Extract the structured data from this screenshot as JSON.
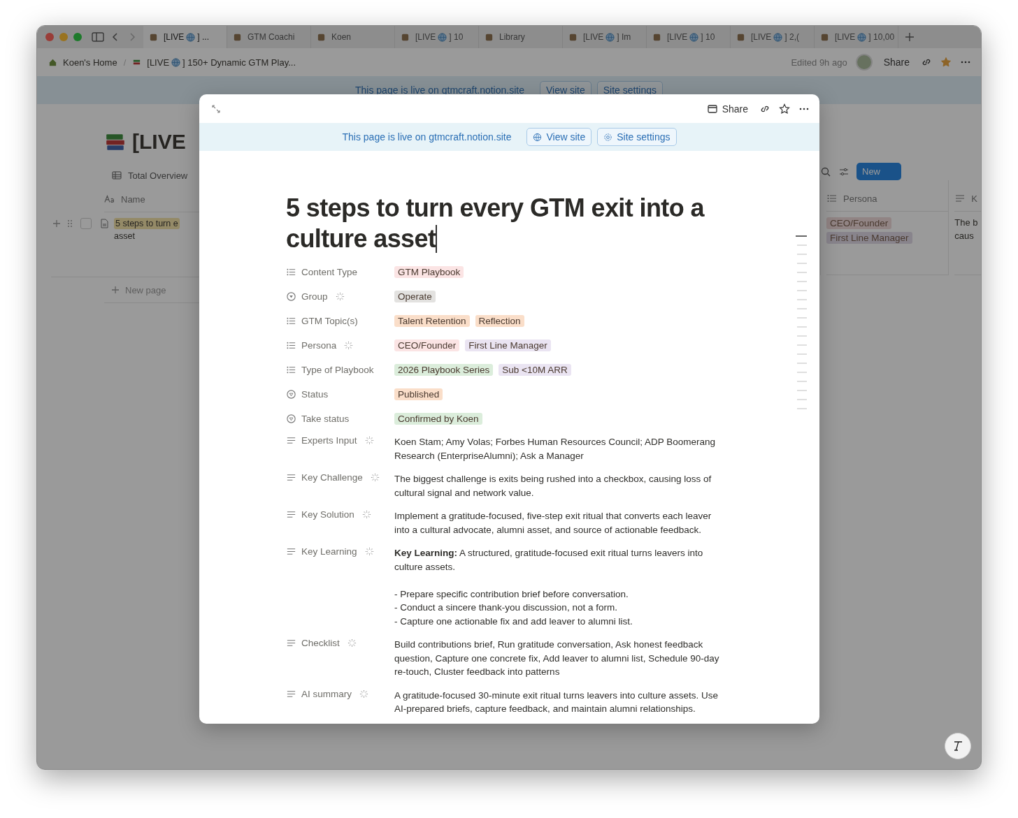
{
  "browser_tabs": [
    {
      "pre": "[LIVE",
      "globe": true,
      "post": "] ...",
      "selected": true
    },
    {
      "pre": "GTM Coachi",
      "globe": false,
      "selected": false
    },
    {
      "pre": "Koen",
      "globe": false,
      "selected": false
    },
    {
      "pre": "[LIVE",
      "globe": true,
      "post": "] 10",
      "selected": false
    },
    {
      "pre": "Library",
      "globe": false,
      "selected": false
    },
    {
      "pre": "[LIVE",
      "globe": true,
      "post": "] Im",
      "selected": false
    },
    {
      "pre": "[LIVE",
      "globe": true,
      "post": "] 10",
      "selected": false
    },
    {
      "pre": "[LIVE",
      "globe": true,
      "post": "] 2,(",
      "selected": false
    },
    {
      "pre": "[LIVE",
      "globe": true,
      "post": "] 10,00",
      "selected": false
    }
  ],
  "breadcrumb": {
    "home": "Koen's Home",
    "separator": "/",
    "page_pre": "[LIVE",
    "page_post": "] 150+ Dynamic GTM Play..."
  },
  "topbar": {
    "edited": "Edited 9h ago",
    "share": "Share",
    "favorited": true
  },
  "site_banner": {
    "text": "This page is live on gtmcraft.notion.site",
    "view": "View site",
    "settings": "Site settings"
  },
  "background_page": {
    "title": "[LIVE",
    "view_tab": "Total Overview",
    "name_header": "Name",
    "row_checked": false,
    "row_name_lines": [
      "5 steps to turn e",
      "asset"
    ],
    "new_page": "New page",
    "new_button": "New",
    "persona_header": "Persona",
    "persona_tags": [
      {
        "label": "CEO/Founder",
        "color": "#918484"
      },
      {
        "label": "First Line Manager",
        "color": "#88848c"
      }
    ],
    "next_header": "K",
    "next_cell_lines": [
      "The b",
      "caus"
    ]
  },
  "modal": {
    "share": "Share",
    "banner": {
      "text": "This page is live on gtmcraft.notion.site",
      "view": "View site",
      "settings": "Site settings"
    },
    "title": "5 steps to turn every GTM exit into a culture asset",
    "properties": [
      {
        "name": "Content Type",
        "kind": "multi_select",
        "ai": false,
        "tags": [
          {
            "label": "GTM Playbook",
            "color": "#fbe4e4"
          }
        ]
      },
      {
        "name": "Group",
        "kind": "select",
        "ai": true,
        "tags": [
          {
            "label": "Operate",
            "color": "#e3e2e0"
          }
        ]
      },
      {
        "name": "GTM Topic(s)",
        "kind": "multi_select",
        "ai": false,
        "tags": [
          {
            "label": "Talent Retention",
            "color": "#fadec9"
          },
          {
            "label": "Reflection",
            "color": "#fadec9"
          }
        ]
      },
      {
        "name": "Persona",
        "kind": "multi_select",
        "ai": true,
        "tags": [
          {
            "label": "CEO/Founder",
            "color": "#fbe4e4"
          },
          {
            "label": "First Line Manager",
            "color": "#eae4f2"
          }
        ]
      },
      {
        "name": "Type of Playbook",
        "kind": "multi_select",
        "ai": false,
        "tags": [
          {
            "label": "2026 Playbook Series",
            "color": "#dbeddb"
          },
          {
            "label": "Sub <10M ARR",
            "color": "#eae4f2"
          }
        ]
      },
      {
        "name": "Status",
        "kind": "status",
        "ai": false,
        "tags": [
          {
            "label": "Published",
            "color": "#fadec9"
          }
        ]
      },
      {
        "name": "Take status",
        "kind": "status",
        "ai": false,
        "tags": [
          {
            "label": "Confirmed by Koen",
            "color": "#dbeddb"
          }
        ]
      },
      {
        "name": "Experts Input",
        "kind": "text",
        "ai": true,
        "value": "Koen Stam; Amy Volas; Forbes Human Resources Council; ADP Boomerang Research (EnterpriseAlumni); Ask a Manager"
      },
      {
        "name": "Key Challenge",
        "kind": "text",
        "ai": true,
        "value": "The biggest challenge is exits being rushed into a checkbox, causing loss of cultural signal and network value."
      },
      {
        "name": "Key Solution",
        "kind": "text",
        "ai": true,
        "value": "Implement a gratitude-focused, five-step exit ritual that converts each leaver into a cultural advocate, alumni asset, and source of actionable feedback."
      },
      {
        "name": "Key Learning",
        "kind": "text",
        "ai": true,
        "value": "**Key Learning:** A structured, gratitude-focused exit ritual turns leavers into culture assets.",
        "bullets": [
          "- Prepare specific contribution brief before conversation.",
          "- Conduct a sincere thank-you discussion, not a form.",
          "- Capture one actionable fix and add leaver to alumni list."
        ]
      },
      {
        "name": "Checklist",
        "kind": "text",
        "ai": true,
        "value": "Build contributions brief, Run gratitude conversation, Ask honest feedback question, Capture one concrete fix, Add leaver to alumni list, Schedule 90-day re-touch, Cluster feedback into patterns"
      },
      {
        "name": "AI summary",
        "kind": "text",
        "ai": true,
        "value": "A gratitude-focused 30-minute exit ritual turns leavers into culture assets. Use AI-prepared briefs, capture feedback, and maintain alumni relationships."
      }
    ]
  }
}
